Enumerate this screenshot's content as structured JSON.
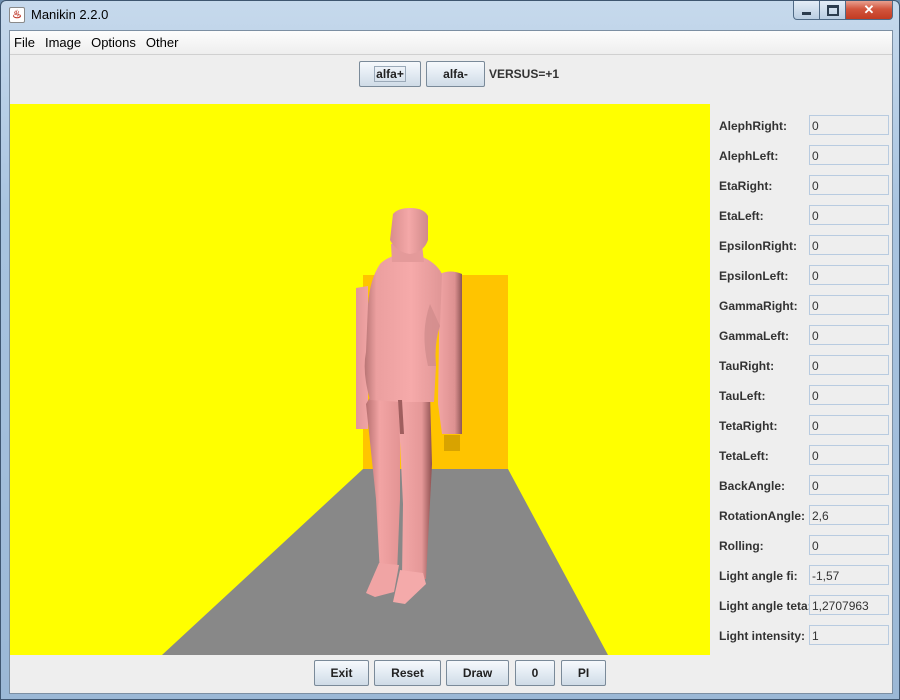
{
  "window": {
    "title": "Manikin 2.2.0",
    "icon": "java-cup-icon",
    "controls": {
      "minimize": "▁",
      "maximize": "▫",
      "close": "✕"
    }
  },
  "menubar": {
    "items": [
      {
        "label": "File"
      },
      {
        "label": "Image"
      },
      {
        "label": "Options"
      },
      {
        "label": "Other"
      }
    ]
  },
  "toolbar": {
    "alfa_plus": "alfa+",
    "alfa_minus": "alfa-",
    "versus": "VERSUS=+1"
  },
  "scene": {
    "colors": {
      "background": "#FFFF00",
      "back_wall": "#FFC400",
      "floor": "#888888",
      "figure": "#F2A4A4",
      "figure_shade": "#C98080"
    }
  },
  "parameters": [
    {
      "label": "AlephRight:",
      "value": "0"
    },
    {
      "label": "AlephLeft:",
      "value": "0"
    },
    {
      "label": "EtaRight:",
      "value": "0"
    },
    {
      "label": "EtaLeft:",
      "value": "0"
    },
    {
      "label": "EpsilonRight:",
      "value": "0"
    },
    {
      "label": "EpsilonLeft:",
      "value": "0"
    },
    {
      "label": "GammaRight:",
      "value": "0"
    },
    {
      "label": "GammaLeft:",
      "value": "0"
    },
    {
      "label": "TauRight:",
      "value": "0"
    },
    {
      "label": "TauLeft:",
      "value": "0"
    },
    {
      "label": "TetaRight:",
      "value": "0"
    },
    {
      "label": "TetaLeft:",
      "value": "0"
    },
    {
      "label": "BackAngle:",
      "value": "0"
    },
    {
      "label": "RotationAngle:",
      "value": "2,6"
    },
    {
      "label": "Rolling:",
      "value": "0"
    },
    {
      "label": "Light angle fi:",
      "value": "-1,57"
    },
    {
      "label": "Light angle teta:",
      "value": "1,2707963"
    },
    {
      "label": "Light intensity:",
      "value": "1"
    }
  ],
  "bottom_buttons": {
    "exit": "Exit",
    "reset": "Reset",
    "draw": "Draw",
    "zero": "0",
    "pi": "PI"
  }
}
